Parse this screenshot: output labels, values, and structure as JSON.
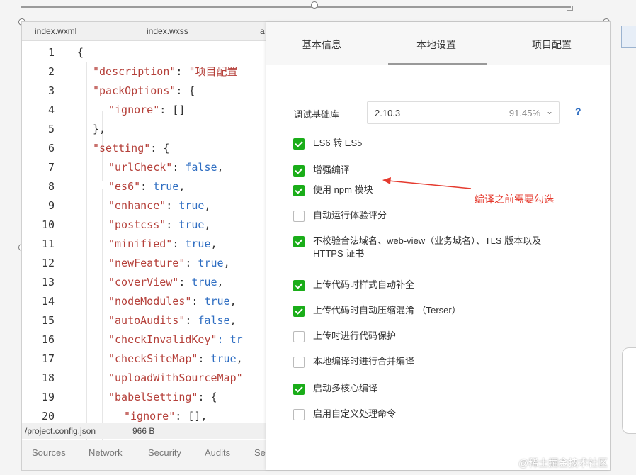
{
  "editor": {
    "tabs": [
      "index.wxml",
      "index.wxss",
      "a"
    ],
    "lines": [
      {
        "n": "1",
        "code": [
          {
            "t": "{",
            "c": "p"
          }
        ]
      },
      {
        "n": "2",
        "code": [
          {
            "t": "\"description\"",
            "c": "k"
          },
          {
            "t": ": ",
            "c": "p"
          },
          {
            "t": "\"项目配置",
            "c": "s"
          }
        ]
      },
      {
        "n": "3",
        "code": [
          {
            "t": "\"packOptions\"",
            "c": "k"
          },
          {
            "t": ": {",
            "c": "p"
          }
        ]
      },
      {
        "n": "4",
        "code": [
          {
            "t": "\"ignore\"",
            "c": "k"
          },
          {
            "t": ": []",
            "c": "p"
          }
        ]
      },
      {
        "n": "5",
        "code": [
          {
            "t": "},",
            "c": "p"
          }
        ]
      },
      {
        "n": "6",
        "code": [
          {
            "t": "\"setting\"",
            "c": "k"
          },
          {
            "t": ": {",
            "c": "p"
          }
        ]
      },
      {
        "n": "7",
        "code": [
          {
            "t": "\"urlCheck\"",
            "c": "k"
          },
          {
            "t": ": ",
            "c": "p"
          },
          {
            "t": "false",
            "c": "b"
          },
          {
            "t": ",",
            "c": "p"
          }
        ]
      },
      {
        "n": "8",
        "code": [
          {
            "t": "\"es6\"",
            "c": "k"
          },
          {
            "t": ": ",
            "c": "p"
          },
          {
            "t": "true",
            "c": "b"
          },
          {
            "t": ",",
            "c": "p"
          }
        ]
      },
      {
        "n": "9",
        "code": [
          {
            "t": "\"enhance\"",
            "c": "k"
          },
          {
            "t": ": ",
            "c": "p"
          },
          {
            "t": "true",
            "c": "b"
          },
          {
            "t": ",",
            "c": "p"
          }
        ]
      },
      {
        "n": "10",
        "code": [
          {
            "t": "\"postcss\"",
            "c": "k"
          },
          {
            "t": ": ",
            "c": "p"
          },
          {
            "t": "true",
            "c": "b"
          },
          {
            "t": ",",
            "c": "p"
          }
        ]
      },
      {
        "n": "11",
        "code": [
          {
            "t": "\"minified\"",
            "c": "k"
          },
          {
            "t": ": ",
            "c": "p"
          },
          {
            "t": "true",
            "c": "b"
          },
          {
            "t": ",",
            "c": "p"
          }
        ]
      },
      {
        "n": "12",
        "code": [
          {
            "t": "\"newFeature\"",
            "c": "k"
          },
          {
            "t": ": ",
            "c": "p"
          },
          {
            "t": "true",
            "c": "b"
          },
          {
            "t": ",",
            "c": "p"
          }
        ]
      },
      {
        "n": "13",
        "code": [
          {
            "t": "\"coverView\"",
            "c": "k"
          },
          {
            "t": ": ",
            "c": "p"
          },
          {
            "t": "true",
            "c": "b"
          },
          {
            "t": ",",
            "c": "p"
          }
        ]
      },
      {
        "n": "14",
        "code": [
          {
            "t": "\"nodeModules\"",
            "c": "k"
          },
          {
            "t": ": ",
            "c": "p"
          },
          {
            "t": "true",
            "c": "b"
          },
          {
            "t": ",",
            "c": "p"
          }
        ]
      },
      {
        "n": "15",
        "code": [
          {
            "t": "\"autoAudits\"",
            "c": "k"
          },
          {
            "t": ": ",
            "c": "p"
          },
          {
            "t": "false",
            "c": "b"
          },
          {
            "t": ",",
            "c": "p"
          }
        ]
      },
      {
        "n": "16",
        "code": [
          {
            "t": "\"checkInvalidKey\"",
            "c": "k"
          },
          {
            "t": ": tr",
            "c": "b"
          }
        ]
      },
      {
        "n": "17",
        "code": [
          {
            "t": "\"checkSiteMap\"",
            "c": "k"
          },
          {
            "t": ": ",
            "c": "p"
          },
          {
            "t": "true",
            "c": "b"
          },
          {
            "t": ",",
            "c": "p"
          }
        ]
      },
      {
        "n": "18",
        "code": [
          {
            "t": "\"uploadWithSourceMap\"",
            "c": "k"
          }
        ]
      },
      {
        "n": "19",
        "code": [
          {
            "t": "\"babelSetting\"",
            "c": "k"
          },
          {
            "t": ": {",
            "c": "p"
          }
        ]
      },
      {
        "n": "20",
        "code": [
          {
            "t": "\"ignore\"",
            "c": "k"
          },
          {
            "t": ": [],",
            "c": "p"
          }
        ]
      }
    ],
    "status_file": "/project.config.json",
    "status_size": "966 B",
    "devtools_tabs": [
      "Sources",
      "Network",
      "Security",
      "Audits",
      "Se"
    ]
  },
  "panel": {
    "tabs": [
      "基本信息",
      "本地设置",
      "项目配置"
    ],
    "active_tab": "本地设置",
    "base_lib_label": "调试基础库",
    "base_lib_value": "2.10.3",
    "base_lib_pct": "91.45%",
    "help_glyph": "?",
    "options": [
      {
        "label": "ES6 转 ES5",
        "checked": true
      },
      {
        "label": "增强编译",
        "checked": true
      },
      {
        "label": "使用 npm 模块",
        "checked": true
      },
      {
        "label": "自动运行体验评分",
        "checked": false
      },
      {
        "label": "不校验合法域名、web-view（业务域名）、TLS 版本以及 HTTPS 证书",
        "checked": true
      },
      {
        "label": "上传代码时样式自动补全",
        "checked": true
      },
      {
        "label": "上传代码时自动压缩混淆 （Terser）",
        "checked": true
      },
      {
        "label": "上传时进行代码保护",
        "checked": false
      },
      {
        "label": "本地编译时进行合并编译",
        "checked": false
      },
      {
        "label": "启动多核心编译",
        "checked": true
      },
      {
        "label": "启用自定义处理命令",
        "checked": false
      }
    ]
  },
  "annotation": {
    "text": "编译之前需要勾选",
    "color": "#e53a2e"
  },
  "watermark": "@稀土掘金技术社区",
  "colors": {
    "check": "#1aad19",
    "keyword": "#b5403a",
    "literal": "#2f6ec2"
  }
}
